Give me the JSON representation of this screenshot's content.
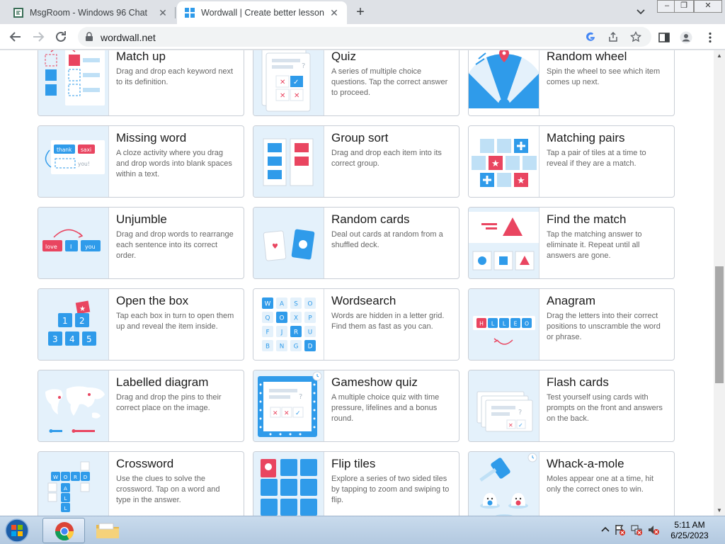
{
  "browser": {
    "tabs": [
      {
        "title": "MsgRoom - Windows 96 Chat",
        "active": false
      },
      {
        "title": "Wordwall | Create better lessons",
        "active": true
      }
    ],
    "url": "wordwall.net"
  },
  "activities": [
    {
      "title": "Match up",
      "description": "Drag and drop each keyword next to its definition.",
      "icon": "match-up-icon"
    },
    {
      "title": "Quiz",
      "description": "A series of multiple choice questions. Tap the correct answer to proceed.",
      "icon": "quiz-icon"
    },
    {
      "title": "Random wheel",
      "description": "Spin the wheel to see which item comes up next.",
      "icon": "random-wheel-icon"
    },
    {
      "title": "Missing word",
      "description": "A cloze activity where you drag and drop words into blank spaces within a text.",
      "icon": "missing-word-icon",
      "thumb_words": [
        "thank",
        "saxi",
        "you!"
      ]
    },
    {
      "title": "Group sort",
      "description": "Drag and drop each item into its correct group.",
      "icon": "group-sort-icon"
    },
    {
      "title": "Matching pairs",
      "description": "Tap a pair of tiles at a time to reveal if they are a match.",
      "icon": "matching-pairs-icon"
    },
    {
      "title": "Unjumble",
      "description": "Drag and drop words to rearrange each sentence into its correct order.",
      "icon": "unjumble-icon",
      "thumb_words": [
        "love",
        "I",
        "you"
      ]
    },
    {
      "title": "Random cards",
      "description": "Deal out cards at random from a shuffled deck.",
      "icon": "random-cards-icon"
    },
    {
      "title": "Find the match",
      "description": "Tap the matching answer to eliminate it. Repeat until all answers are gone.",
      "icon": "find-the-match-icon"
    },
    {
      "title": "Open the box",
      "description": "Tap each box in turn to open them up and reveal the item inside.",
      "icon": "open-the-box-icon",
      "thumb_numbers": [
        "1",
        "2",
        "3",
        "4",
        "5"
      ]
    },
    {
      "title": "Wordsearch",
      "description": "Words are hidden in a letter grid. Find them as fast as you can.",
      "icon": "wordsearch-icon",
      "thumb_letters": [
        "W",
        "A",
        "S",
        "O",
        "Q",
        "O",
        "X",
        "P",
        "F",
        "J",
        "R",
        "U",
        "B",
        "N",
        "G",
        "D"
      ]
    },
    {
      "title": "Anagram",
      "description": "Drag the letters into their correct positions to unscramble the word or phrase.",
      "icon": "anagram-icon",
      "thumb_letters": [
        "H",
        "L",
        "L",
        "E",
        "O"
      ]
    },
    {
      "title": "Labelled diagram",
      "description": "Drag and drop the pins to their correct place on the image.",
      "icon": "labelled-diagram-icon"
    },
    {
      "title": "Gameshow quiz",
      "description": "A multiple choice quiz with time pressure, lifelines and a bonus round.",
      "icon": "gameshow-quiz-icon"
    },
    {
      "title": "Flash cards",
      "description": "Test yourself using cards with prompts on the front and answers on the back.",
      "icon": "flash-cards-icon"
    },
    {
      "title": "Crossword",
      "description": "Use the clues to solve the crossword. Tap on a word and type in the answer.",
      "icon": "crossword-icon",
      "thumb_letters": [
        "W",
        "O",
        "R",
        "D",
        "A",
        "L",
        "L"
      ]
    },
    {
      "title": "Flip tiles",
      "description": "Explore a series of two sided tiles by tapping to zoom and swiping to flip.",
      "icon": "flip-tiles-icon"
    },
    {
      "title": "Whack-a-mole",
      "description": "Moles appear one at a time, hit only the correct ones to win.",
      "icon": "whack-a-mole-icon"
    }
  ],
  "taskbar": {
    "time": "5:11 AM",
    "date": "6/25/2023"
  },
  "colors": {
    "thumb_bg": "#e4f1fb",
    "wordwall_blue": "#2f9bea",
    "wordwall_red": "#e94560"
  }
}
